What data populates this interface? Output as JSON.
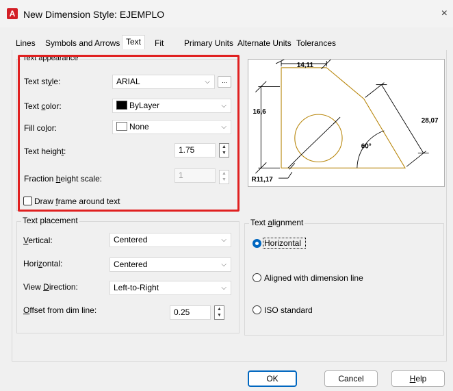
{
  "window": {
    "app_icon_letter": "A",
    "title": "New Dimension Style: EJEMPLO",
    "close_glyph": "×"
  },
  "tabs": [
    {
      "label": "Lines",
      "active": false
    },
    {
      "label": "Symbols and Arrows",
      "active": false
    },
    {
      "label": "Text",
      "active": true
    },
    {
      "label": "Fit",
      "active": false
    },
    {
      "label": "Primary Units",
      "active": false
    },
    {
      "label": "Alternate Units",
      "active": false
    },
    {
      "label": "Tolerances",
      "active": false
    }
  ],
  "text_appearance": {
    "title": "Text appearance",
    "text_style_label_pre": "Text st",
    "text_style_label_u": "y",
    "text_style_label_post": "le:",
    "text_style_value": "ARIAL",
    "text_style_browse": "...",
    "text_color_label_pre": "Text ",
    "text_color_label_u": "c",
    "text_color_label_post": "olor:",
    "text_color_value": "ByLayer",
    "fill_color_label_pre": "Fill co",
    "fill_color_label_u": "l",
    "fill_color_label_post": "or:",
    "fill_color_value": "None",
    "text_height_label_pre": "Text heigh",
    "text_height_label_u": "t",
    "text_height_label_post": ":",
    "text_height_value": "1.75",
    "fraction_label_pre": "Fraction ",
    "fraction_label_u": "h",
    "fraction_label_post": "eight scale:",
    "fraction_value": "1",
    "frame_label_pre": "Draw ",
    "frame_label_u": "f",
    "frame_label_post": "rame around text",
    "frame_checked": false
  },
  "text_placement": {
    "title": "Text placement",
    "vertical_label_u": "V",
    "vertical_label_post": "ertical:",
    "vertical_value": "Centered",
    "horizontal_label_pre": "Hori",
    "horizontal_label_u": "z",
    "horizontal_label_post": "ontal:",
    "horizontal_value": "Centered",
    "view_label_pre": "View ",
    "view_label_u": "D",
    "view_label_post": "irection:",
    "view_value": "Left-to-Right",
    "offset_label_u": "O",
    "offset_label_post": "ffset from dim line:",
    "offset_value": "0.25"
  },
  "text_alignment": {
    "title_pre": "Text ",
    "title_u": "a",
    "title_post": "lignment",
    "options": [
      {
        "label": "Horizontal",
        "checked": true
      },
      {
        "label": "Aligned with dimension line",
        "checked": false
      },
      {
        "label": "ISO standard",
        "checked": false
      }
    ]
  },
  "preview": {
    "dim_top": "14,11",
    "dim_left": "16,6",
    "dim_right": "28,07",
    "dim_angle": "60°",
    "dim_radius": "R11,17"
  },
  "buttons": {
    "ok": "OK",
    "cancel": "Cancel",
    "help_u": "H",
    "help_post": "elp"
  },
  "colors": {
    "accent": "#0067c0",
    "highlight_box": "#e02020",
    "preview_geometry": "#b8860b",
    "app_icon": "#d31f26"
  }
}
